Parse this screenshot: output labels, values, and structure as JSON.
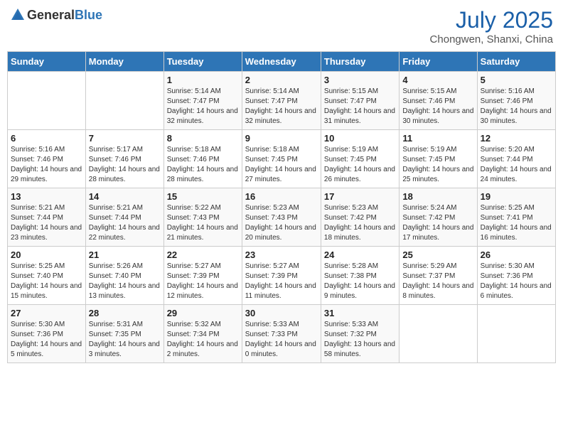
{
  "header": {
    "logo_general": "General",
    "logo_blue": "Blue",
    "month_year": "July 2025",
    "location": "Chongwen, Shanxi, China"
  },
  "columns": [
    "Sunday",
    "Monday",
    "Tuesday",
    "Wednesday",
    "Thursday",
    "Friday",
    "Saturday"
  ],
  "weeks": [
    [
      {
        "day": "",
        "info": ""
      },
      {
        "day": "",
        "info": ""
      },
      {
        "day": "1",
        "info": "Sunrise: 5:14 AM\nSunset: 7:47 PM\nDaylight: 14 hours and 32 minutes."
      },
      {
        "day": "2",
        "info": "Sunrise: 5:14 AM\nSunset: 7:47 PM\nDaylight: 14 hours and 32 minutes."
      },
      {
        "day": "3",
        "info": "Sunrise: 5:15 AM\nSunset: 7:47 PM\nDaylight: 14 hours and 31 minutes."
      },
      {
        "day": "4",
        "info": "Sunrise: 5:15 AM\nSunset: 7:46 PM\nDaylight: 14 hours and 30 minutes."
      },
      {
        "day": "5",
        "info": "Sunrise: 5:16 AM\nSunset: 7:46 PM\nDaylight: 14 hours and 30 minutes."
      }
    ],
    [
      {
        "day": "6",
        "info": "Sunrise: 5:16 AM\nSunset: 7:46 PM\nDaylight: 14 hours and 29 minutes."
      },
      {
        "day": "7",
        "info": "Sunrise: 5:17 AM\nSunset: 7:46 PM\nDaylight: 14 hours and 28 minutes."
      },
      {
        "day": "8",
        "info": "Sunrise: 5:18 AM\nSunset: 7:46 PM\nDaylight: 14 hours and 28 minutes."
      },
      {
        "day": "9",
        "info": "Sunrise: 5:18 AM\nSunset: 7:45 PM\nDaylight: 14 hours and 27 minutes."
      },
      {
        "day": "10",
        "info": "Sunrise: 5:19 AM\nSunset: 7:45 PM\nDaylight: 14 hours and 26 minutes."
      },
      {
        "day": "11",
        "info": "Sunrise: 5:19 AM\nSunset: 7:45 PM\nDaylight: 14 hours and 25 minutes."
      },
      {
        "day": "12",
        "info": "Sunrise: 5:20 AM\nSunset: 7:44 PM\nDaylight: 14 hours and 24 minutes."
      }
    ],
    [
      {
        "day": "13",
        "info": "Sunrise: 5:21 AM\nSunset: 7:44 PM\nDaylight: 14 hours and 23 minutes."
      },
      {
        "day": "14",
        "info": "Sunrise: 5:21 AM\nSunset: 7:44 PM\nDaylight: 14 hours and 22 minutes."
      },
      {
        "day": "15",
        "info": "Sunrise: 5:22 AM\nSunset: 7:43 PM\nDaylight: 14 hours and 21 minutes."
      },
      {
        "day": "16",
        "info": "Sunrise: 5:23 AM\nSunset: 7:43 PM\nDaylight: 14 hours and 20 minutes."
      },
      {
        "day": "17",
        "info": "Sunrise: 5:23 AM\nSunset: 7:42 PM\nDaylight: 14 hours and 18 minutes."
      },
      {
        "day": "18",
        "info": "Sunrise: 5:24 AM\nSunset: 7:42 PM\nDaylight: 14 hours and 17 minutes."
      },
      {
        "day": "19",
        "info": "Sunrise: 5:25 AM\nSunset: 7:41 PM\nDaylight: 14 hours and 16 minutes."
      }
    ],
    [
      {
        "day": "20",
        "info": "Sunrise: 5:25 AM\nSunset: 7:40 PM\nDaylight: 14 hours and 15 minutes."
      },
      {
        "day": "21",
        "info": "Sunrise: 5:26 AM\nSunset: 7:40 PM\nDaylight: 14 hours and 13 minutes."
      },
      {
        "day": "22",
        "info": "Sunrise: 5:27 AM\nSunset: 7:39 PM\nDaylight: 14 hours and 12 minutes."
      },
      {
        "day": "23",
        "info": "Sunrise: 5:27 AM\nSunset: 7:39 PM\nDaylight: 14 hours and 11 minutes."
      },
      {
        "day": "24",
        "info": "Sunrise: 5:28 AM\nSunset: 7:38 PM\nDaylight: 14 hours and 9 minutes."
      },
      {
        "day": "25",
        "info": "Sunrise: 5:29 AM\nSunset: 7:37 PM\nDaylight: 14 hours and 8 minutes."
      },
      {
        "day": "26",
        "info": "Sunrise: 5:30 AM\nSunset: 7:36 PM\nDaylight: 14 hours and 6 minutes."
      }
    ],
    [
      {
        "day": "27",
        "info": "Sunrise: 5:30 AM\nSunset: 7:36 PM\nDaylight: 14 hours and 5 minutes."
      },
      {
        "day": "28",
        "info": "Sunrise: 5:31 AM\nSunset: 7:35 PM\nDaylight: 14 hours and 3 minutes."
      },
      {
        "day": "29",
        "info": "Sunrise: 5:32 AM\nSunset: 7:34 PM\nDaylight: 14 hours and 2 minutes."
      },
      {
        "day": "30",
        "info": "Sunrise: 5:33 AM\nSunset: 7:33 PM\nDaylight: 14 hours and 0 minutes."
      },
      {
        "day": "31",
        "info": "Sunrise: 5:33 AM\nSunset: 7:32 PM\nDaylight: 13 hours and 58 minutes."
      },
      {
        "day": "",
        "info": ""
      },
      {
        "day": "",
        "info": ""
      }
    ]
  ]
}
